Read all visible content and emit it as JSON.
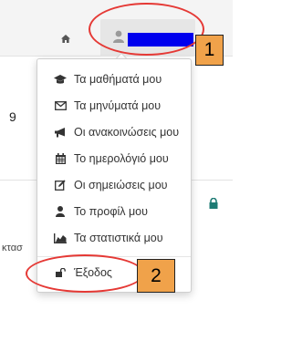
{
  "user_menu": {
    "username_visible": false,
    "items": [
      {
        "label": "Τα μαθήματά μου",
        "icon": "graduation-cap-icon"
      },
      {
        "label": "Τα μηνύματά μου",
        "icon": "envelope-icon"
      },
      {
        "label": "Οι ανακοινώσεις μου",
        "icon": "bullhorn-icon"
      },
      {
        "label": "Το ημερολόγιό μου",
        "icon": "calendar-icon"
      },
      {
        "label": "Οι σημειώσεις μου",
        "icon": "edit-icon"
      },
      {
        "label": "Το προφίλ μου",
        "icon": "user-icon"
      },
      {
        "label": "Τα στατιστικά μου",
        "icon": "area-chart-icon"
      }
    ],
    "logout": {
      "label": "Έξοδος",
      "icon": "unlock-icon"
    }
  },
  "annotations": {
    "label_1": "1",
    "label_2": "2",
    "color": "#e53935"
  },
  "background": {
    "number": "9",
    "card_text": "κτασ"
  },
  "colors": {
    "accent": "#0000ee",
    "icon_teal": "#1e7b74",
    "annotation_fill": "#f0a24a"
  }
}
